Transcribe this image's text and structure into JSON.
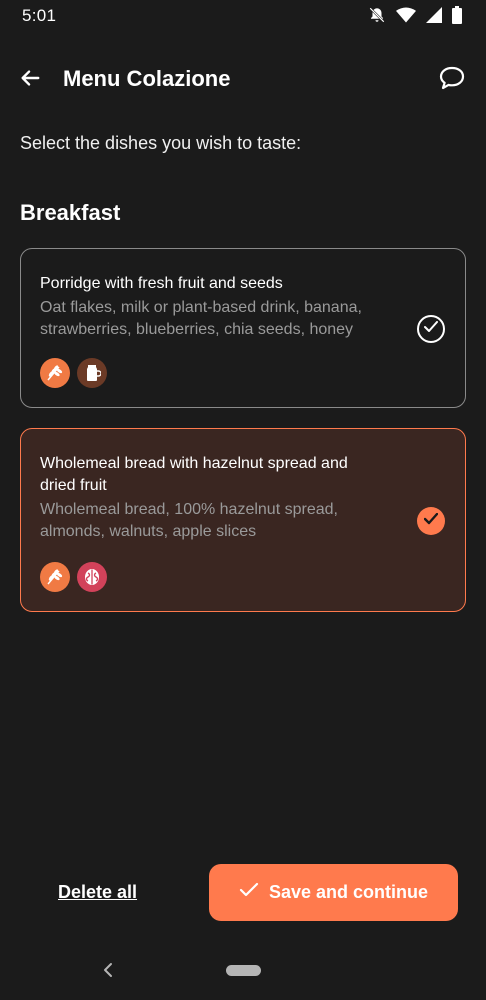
{
  "status_bar": {
    "time": "5:01",
    "icons": [
      "notifications-off-icon",
      "wifi-icon",
      "signal-icon",
      "battery-icon"
    ]
  },
  "app_bar": {
    "title": "Menu Colazione",
    "back_icon": "arrow-left-icon",
    "chat_icon": "chat-bubble-icon"
  },
  "instructions": "Select the dishes you wish to taste:",
  "section": {
    "title": "Breakfast"
  },
  "dishes": [
    {
      "name": "Porridge with fresh fruit and seeds",
      "description": "Oat flakes, milk or plant-based drink, banana, strawberries, blueberries, chia seeds, honey",
      "allergens": [
        "wheat-icon",
        "milk-jug-icon"
      ],
      "selected": false
    },
    {
      "name": "Wholemeal bread with hazelnut spread and dried fruit",
      "description": "Wholemeal bread, 100% hazelnut spread, almonds, walnuts, apple slices",
      "allergens": [
        "wheat-icon",
        "walnut-icon"
      ],
      "selected": true
    }
  ],
  "actions": {
    "delete_label": "Delete all",
    "save_label": "Save and continue"
  },
  "colors": {
    "background": "#1b1b1b",
    "accent": "#ff7a4d",
    "selected_card_bg": "#3a2621",
    "muted_text": "#9a9a9a"
  }
}
